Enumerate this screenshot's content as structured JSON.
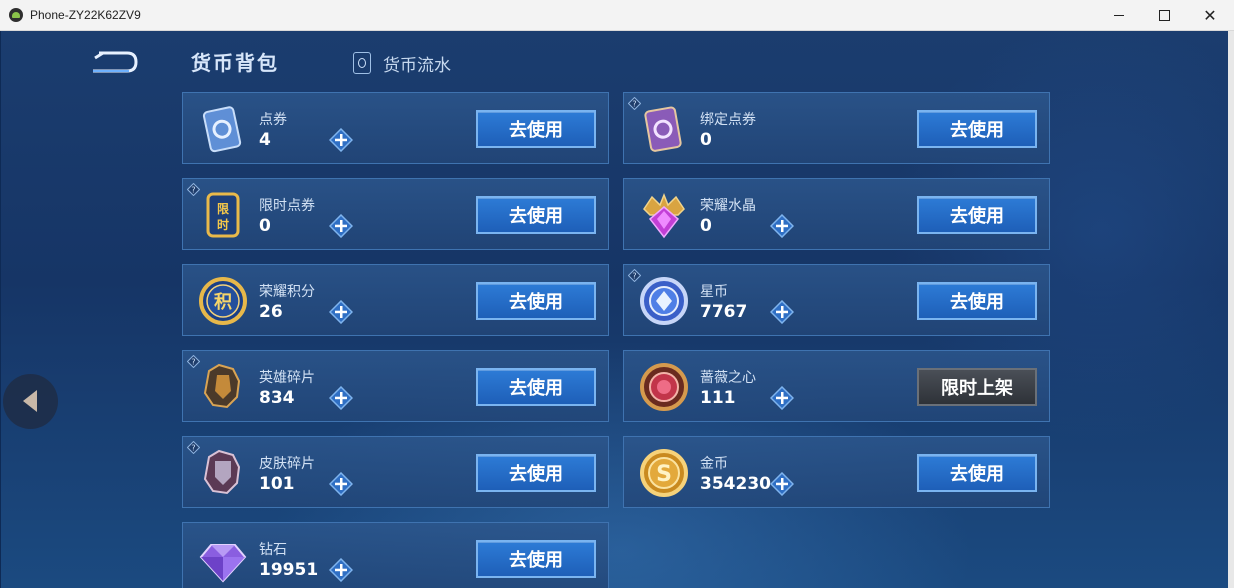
{
  "window": {
    "title": "Phone-ZY22K62ZV9",
    "min_icon": "minimize-icon",
    "max_icon": "maximize-icon",
    "close_icon": "close-icon",
    "close_glyph": "✕"
  },
  "header": {
    "title": "货币背包",
    "tab_flow": "货币流水"
  },
  "button_label": "去使用",
  "cards": [
    {
      "name": "点券",
      "value": "4",
      "icon": "coupon-icon",
      "plus": true,
      "button": "去使用"
    },
    {
      "name": "绑定点券",
      "value": "0",
      "icon": "bound-coupon-icon",
      "plus": false,
      "button": "去使用"
    },
    {
      "name": "限时点券",
      "value": "0",
      "icon": "limited-coupon-icon",
      "plus": true,
      "button": "去使用"
    },
    {
      "name": "荣耀水晶",
      "value": "0",
      "icon": "glory-crystal-icon",
      "plus": true,
      "button": "去使用"
    },
    {
      "name": "荣耀积分",
      "value": "26",
      "icon": "glory-points-icon",
      "plus": true,
      "button": "去使用"
    },
    {
      "name": "星币",
      "value": "7767",
      "icon": "star-coin-icon",
      "plus": true,
      "button": "去使用"
    },
    {
      "name": "英雄碎片",
      "value": "834",
      "icon": "hero-fragment-icon",
      "plus": true,
      "button": "去使用"
    },
    {
      "name": "蔷薇之心",
      "value": "111",
      "icon": "rose-heart-icon",
      "plus": true,
      "button": "限时上架"
    },
    {
      "name": "皮肤碎片",
      "value": "101",
      "icon": "skin-fragment-icon",
      "plus": true,
      "button": "去使用"
    },
    {
      "name": "金币",
      "value": "354230",
      "icon": "gold-coin-icon",
      "plus": true,
      "button": "去使用"
    },
    {
      "name": "钻石",
      "value": "19951",
      "icon": "diamond-icon",
      "plus": true,
      "button": "去使用"
    }
  ],
  "colors": {
    "accent_blue": "#2d7bd6",
    "card_border": "#3f73b0",
    "disabled_gray": "#3c4047"
  }
}
